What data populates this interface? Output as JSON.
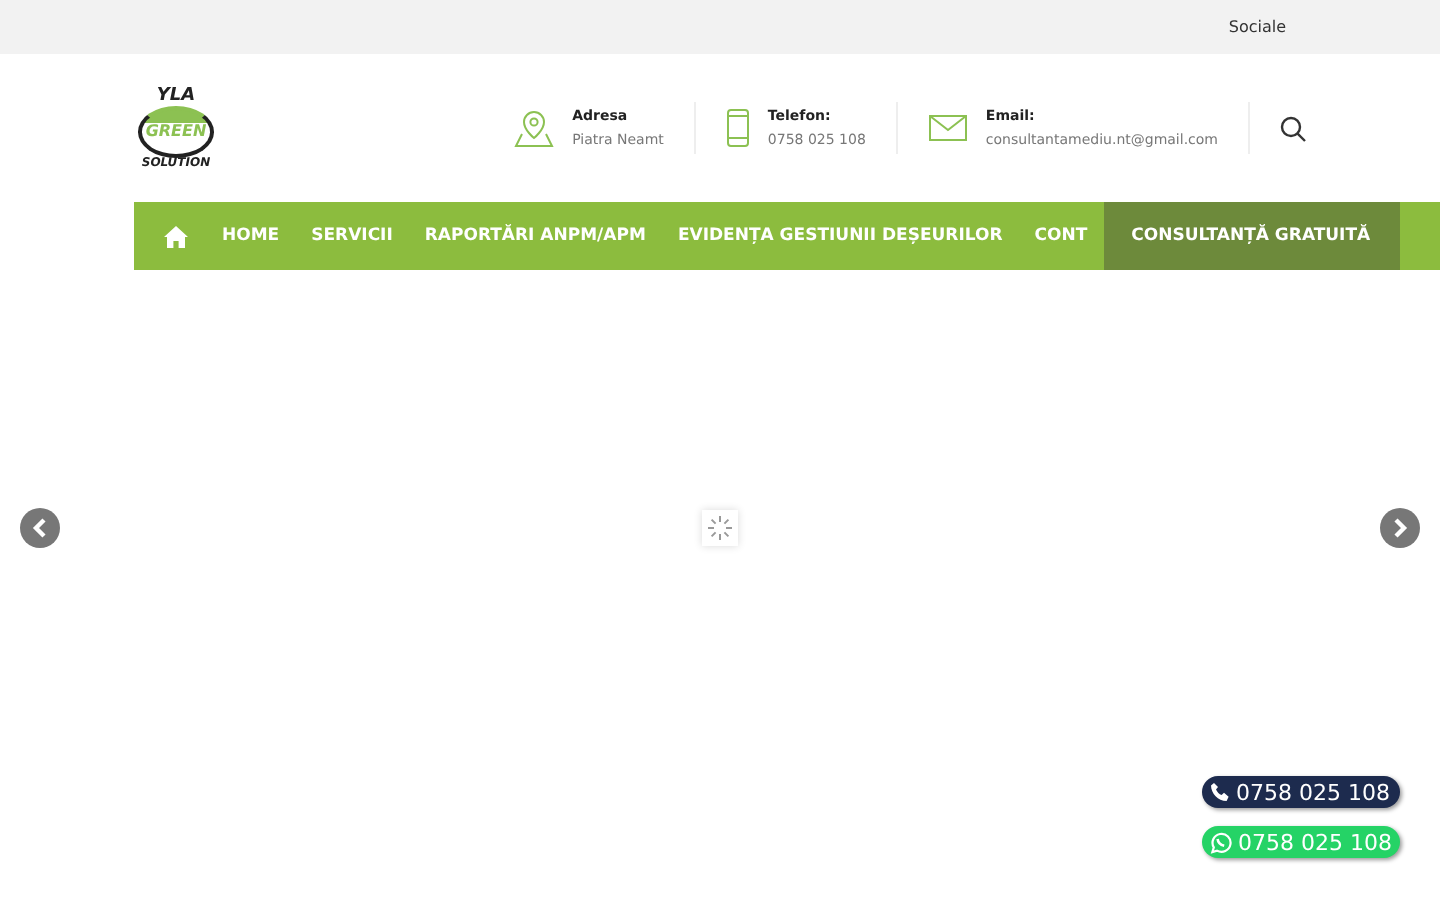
{
  "topbar": {
    "link": "Sociale"
  },
  "logo": {
    "top": "YLA",
    "middle": "GREEN",
    "bottom": "SOLUTION"
  },
  "contacts": [
    {
      "kind": "pin",
      "label": "Adresa",
      "value": "Piatra Neamt"
    },
    {
      "kind": "phone",
      "label": "Telefon:",
      "value": "0758 025 108"
    },
    {
      "kind": "mail",
      "label": "Email:",
      "value": "consultantamediu.nt@gmail.com"
    }
  ],
  "nav": {
    "items": [
      {
        "label": "HOME"
      },
      {
        "label": "SERVICII"
      },
      {
        "label": "RAPORTĂRI ANPM/APM"
      },
      {
        "label": "EVIDENȚA GESTIUNII DEȘEURILOR"
      },
      {
        "label": "CONT"
      }
    ],
    "cta": "CONSULTANȚĂ GRATUITĂ"
  },
  "floating": [
    {
      "kind": "phone",
      "label": "0758 025 108"
    },
    {
      "kind": "whatsapp",
      "label": "0758 025 108"
    }
  ]
}
